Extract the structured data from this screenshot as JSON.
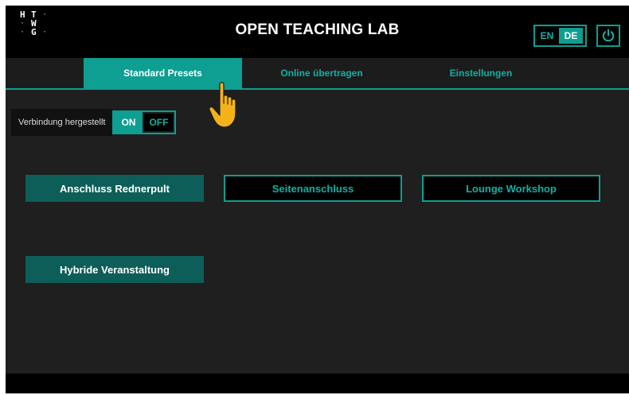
{
  "header": {
    "logo": {
      "l1": "H",
      "l2": "T",
      "l3": "W",
      "l4": "G"
    },
    "title": "OPEN TEACHING LAB",
    "languages": [
      {
        "label": "EN",
        "active": false
      },
      {
        "label": "DE",
        "active": true
      }
    ],
    "power_icon": "power-icon"
  },
  "tabs": [
    {
      "label": "Standard Presets",
      "active": true
    },
    {
      "label": "Online übertragen",
      "active": false
    },
    {
      "label": "Einstellungen",
      "active": false
    }
  ],
  "status": {
    "label": "Verbindung hergestellt",
    "toggle_on": "ON",
    "toggle_off": "OFF",
    "state": "ON"
  },
  "presets": [
    {
      "label": "Anschluss Rednerpult",
      "selected": true
    },
    {
      "label": "Seitenanschluss",
      "selected": false
    },
    {
      "label": "Lounge Workshop",
      "selected": false
    },
    {
      "label": "Hybride Veranstaltung",
      "selected": true
    }
  ],
  "colors": {
    "accent": "#0e9e92",
    "accent_dark": "#0d5e58",
    "cursor": "#f4b21a"
  }
}
